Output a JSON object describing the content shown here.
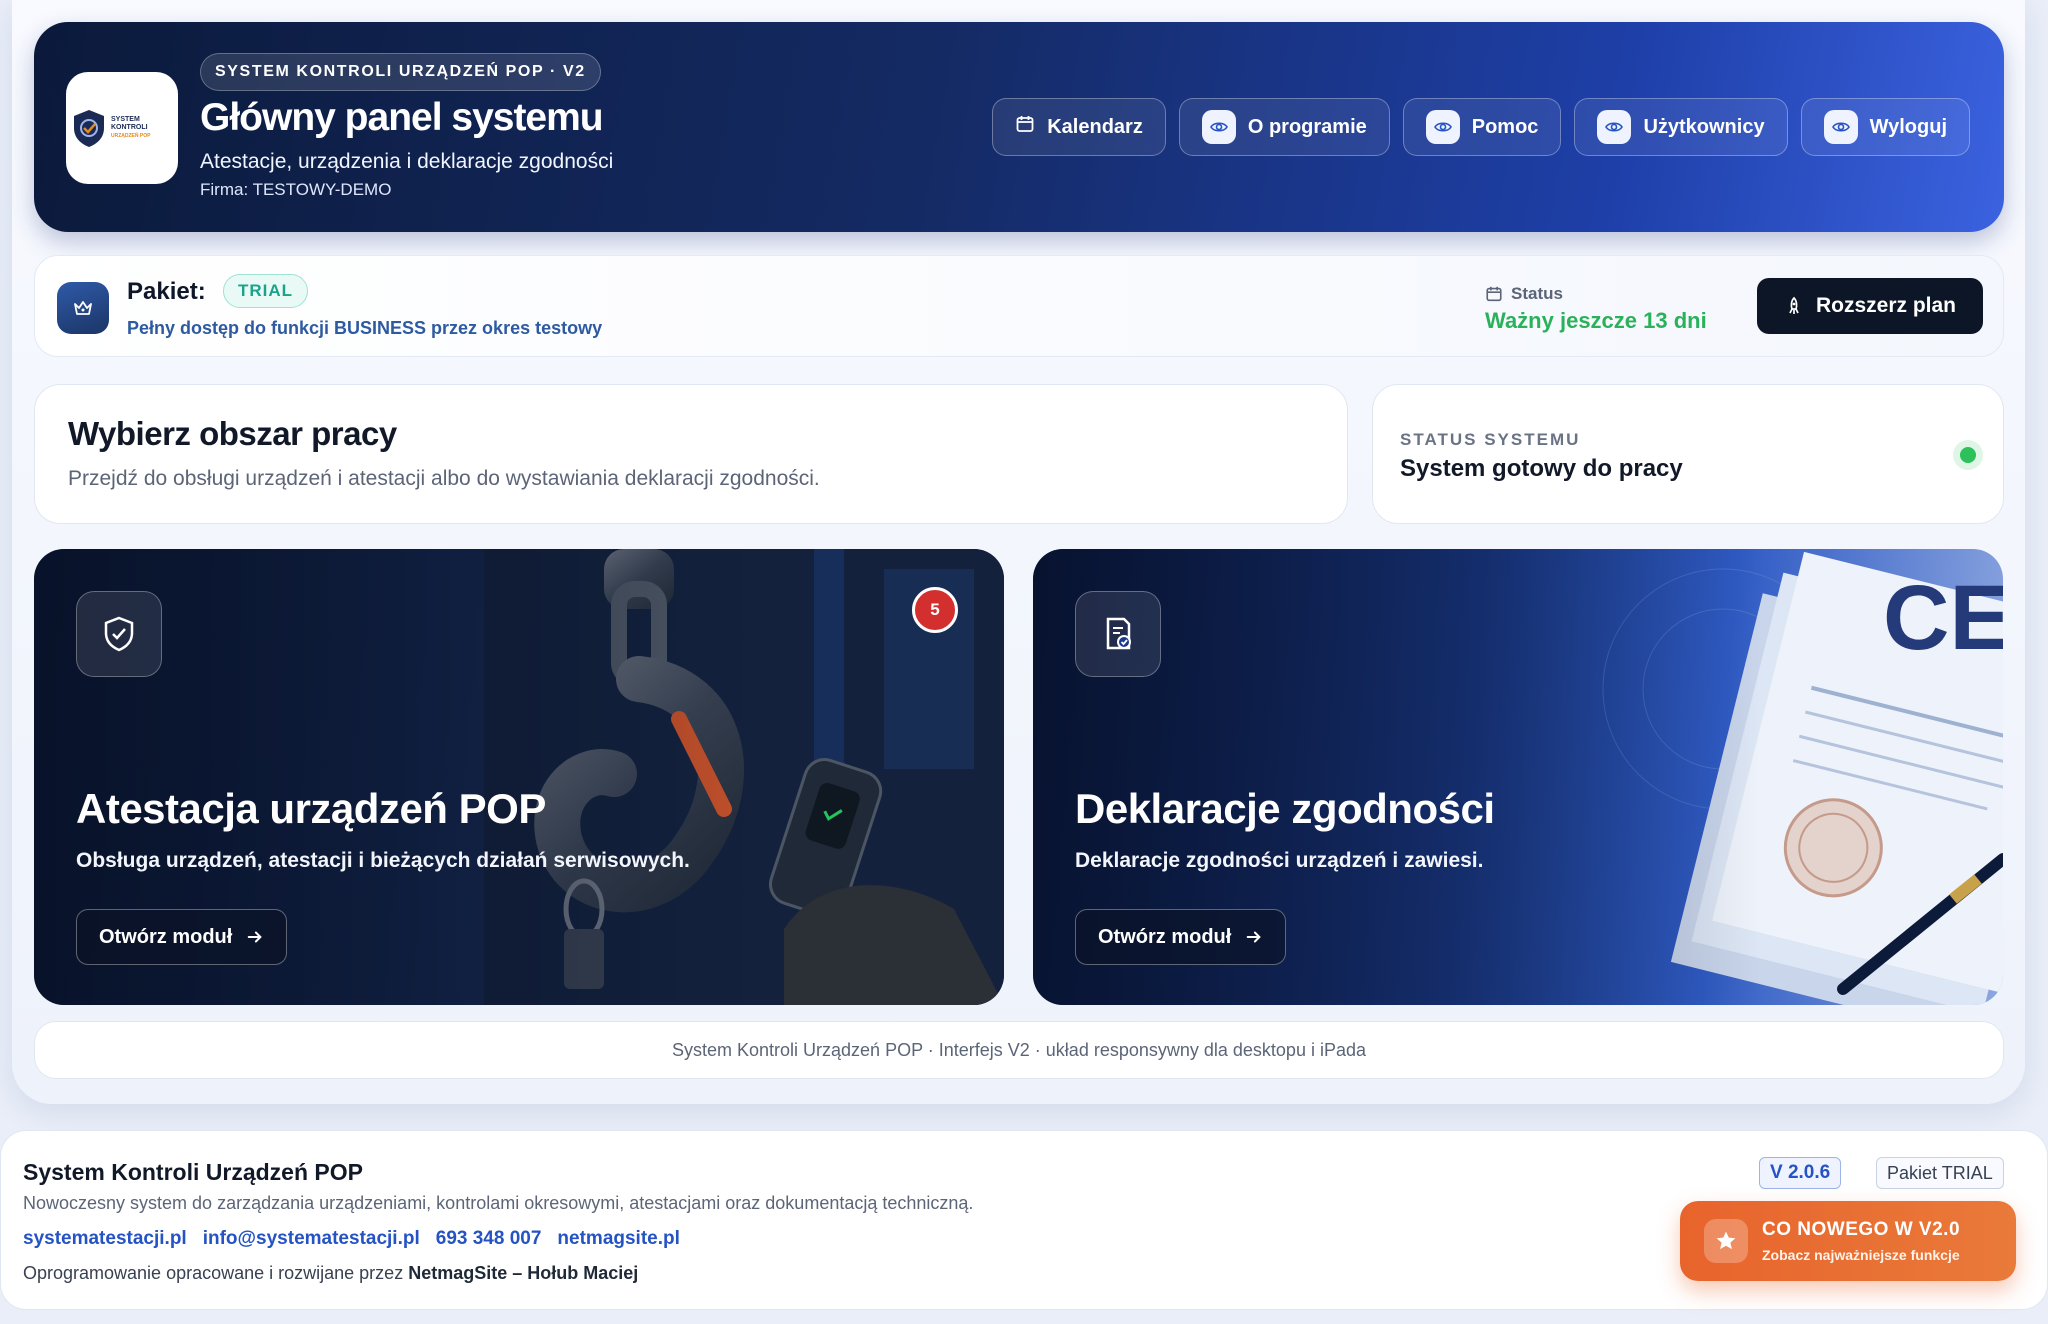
{
  "header": {
    "eyebrow": "SYSTEM KONTROLI URZĄDZEŃ POP · V2",
    "title": "Główny panel systemu",
    "subtitle": "Atestacje, urządzenia i deklaracje zgodności",
    "company": "Firma: TESTOWY-DEMO",
    "logo_text": "SYSTEM KONTROLI",
    "logo_subtext": "URZĄDZEŃ POP",
    "nav": [
      {
        "label": "Kalendarz",
        "icon": "calendar-icon"
      },
      {
        "label": "O programie",
        "icon": "eye-icon"
      },
      {
        "label": "Pomoc",
        "icon": "eye-icon"
      },
      {
        "label": "Użytkownicy",
        "icon": "eye-icon"
      },
      {
        "label": "Wyloguj",
        "icon": "eye-icon"
      }
    ]
  },
  "package": {
    "label": "Pakiet:",
    "badge": "TRIAL",
    "description": "Pełny dostęp do funkcji BUSINESS przez okres testowy",
    "status_label": "Status",
    "status_value": "Ważny jeszcze 13 dni",
    "upgrade_label": "Rozszerz plan"
  },
  "workspace": {
    "title": "Wybierz obszar pracy",
    "description": "Przejdź do obsługi urządzeń i atestacji albo do wystawiania deklaracji zgodności."
  },
  "system_status": {
    "label": "STATUS SYSTEMU",
    "value": "System gotowy do pracy",
    "color": "#2ec05b"
  },
  "modules": [
    {
      "title": "Atestacja urządzeń POP",
      "description": "Obsługa urządzeń, atestacji i bieżących działań serwisowych.",
      "button": "Otwórz moduł",
      "badge_count": "5",
      "icon": "shield-check-icon"
    },
    {
      "title": "Deklaracje zgodności",
      "description": "Deklaracje zgodności urządzeń i zawiesi.",
      "button": "Otwórz moduł",
      "icon": "document-check-icon",
      "mark": "CE"
    }
  ],
  "footnote": "System Kontroli Urządzeń POP · Interfejs V2 · układ responsywny dla desktopu i iPada",
  "footer": {
    "title": "System Kontroli Urządzeń POP",
    "description": "Nowoczesny system do zarządzania urządzeniami, kontrolami okresowymi, atestacjami oraz dokumentacją techniczną.",
    "links": [
      "systematestacji.pl",
      "info@systematestacji.pl",
      "693 348 007",
      "netmagsite.pl"
    ],
    "credit_prefix": "Oprogramowanie opracowane i rozwijane przez",
    "credit_author": "NetmagSite – Hołub Maciej",
    "version": "V 2.0.6",
    "plan": "Pakiet TRIAL"
  },
  "whats_new": {
    "title": "CO NOWEGO W V2.0",
    "subtitle": "Zobacz najważniejsze funkcje"
  },
  "colors": {
    "accent": "#2553c4",
    "header_dark": "#0b1a3b",
    "header_light": "#3b62e0",
    "success": "#2bb15a",
    "danger": "#d32f2f",
    "orange": "#e8642c"
  }
}
